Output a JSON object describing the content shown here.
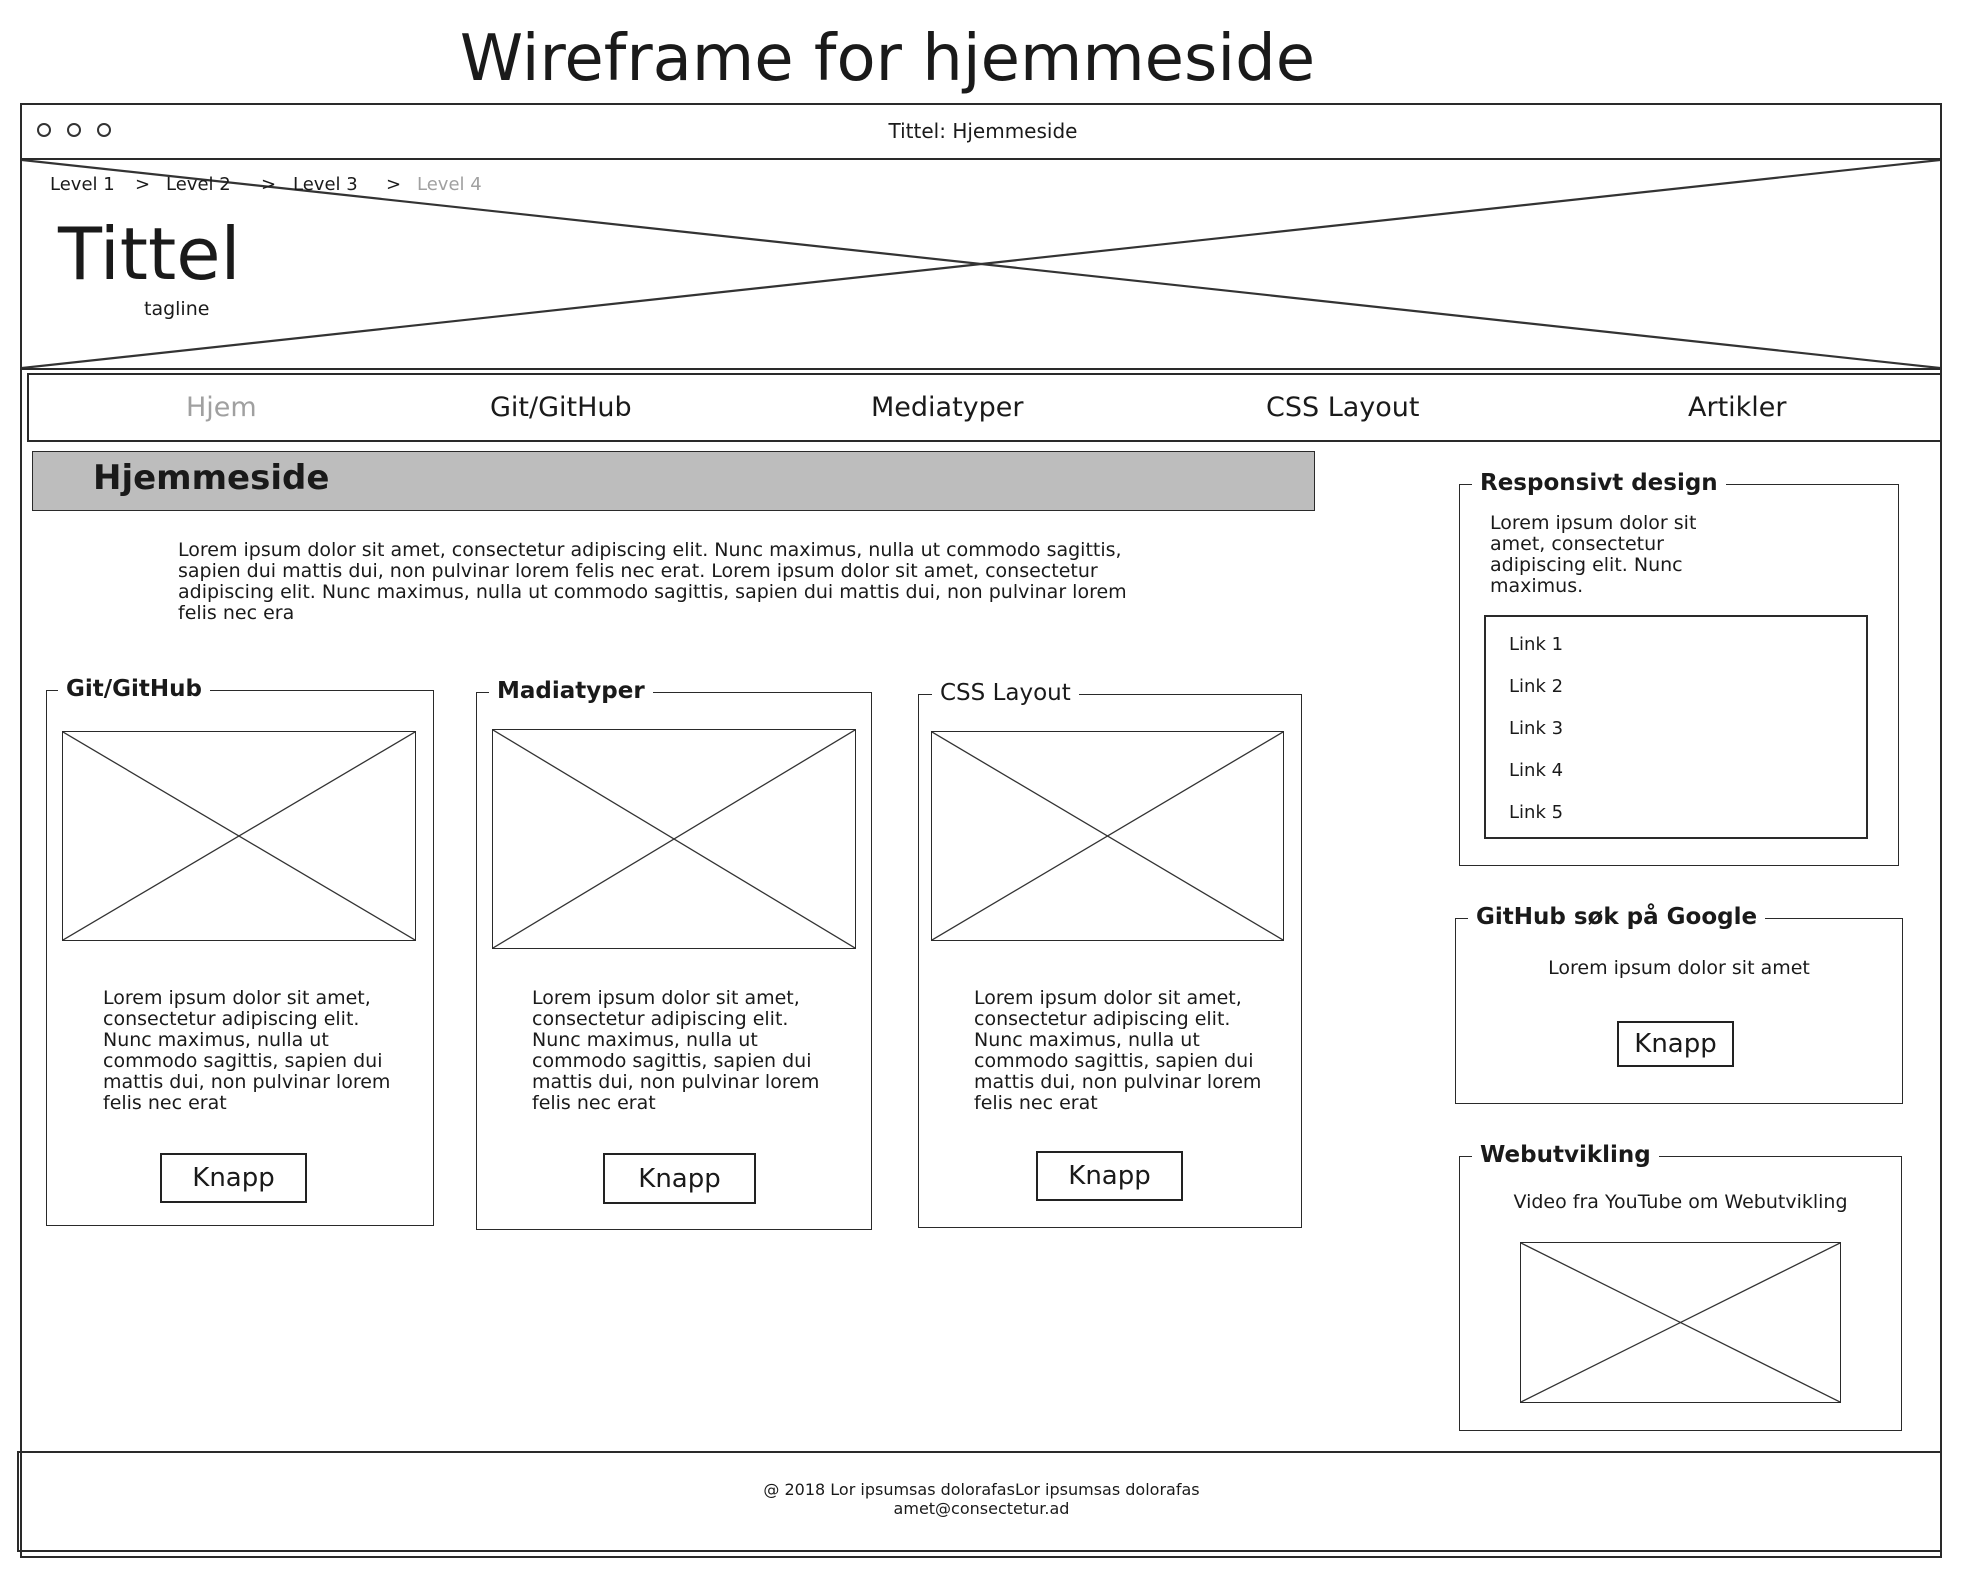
{
  "diagram_title": "Wireframe for hjemmeside",
  "browser": {
    "title": "Tittel: Hjemmeside"
  },
  "breadcrumb": {
    "items": [
      "Level 1",
      "Level 2",
      "Level 3",
      "Level 4"
    ],
    "separator": ">"
  },
  "header": {
    "title": "Tittel",
    "tagline": "tagline"
  },
  "nav": {
    "items": [
      "Hjem",
      "Git/GitHub",
      "Mediatyper",
      "CSS Layout",
      "Artikler"
    ]
  },
  "main": {
    "heading": "Hjemmeside",
    "intro": "Lorem ipsum dolor sit amet, consectetur adipiscing elit. Nunc maximus, nulla ut commodo sagittis, sapien dui mattis dui, non pulvinar lorem felis nec erat. Lorem ipsum dolor sit amet, consectetur adipiscing elit. Nunc maximus, nulla ut commodo sagittis, sapien dui mattis dui, non pulvinar lorem felis nec era",
    "cards": [
      {
        "title": "Git/GitHub",
        "text": "Lorem ipsum dolor sit amet, consectetur adipiscing elit. Nunc maximus, nulla ut commodo sagittis, sapien dui mattis dui, non pulvinar lorem felis nec erat",
        "button": "Knapp"
      },
      {
        "title": "Madiatyper",
        "text": "Lorem ipsum dolor sit amet, consectetur adipiscing elit. Nunc maximus, nulla ut commodo sagittis, sapien dui mattis dui, non pulvinar lorem felis nec erat",
        "button": "Knapp"
      },
      {
        "title": "CSS Layout",
        "text": "Lorem ipsum dolor sit amet, consectetur adipiscing elit. Nunc maximus, nulla ut commodo sagittis, sapien dui mattis dui, non pulvinar lorem felis nec erat",
        "button": "Knapp"
      }
    ]
  },
  "sidebar": {
    "responsive": {
      "title": "Responsivt design",
      "text": "Lorem ipsum dolor sit amet, consectetur adipiscing elit. Nunc maximus.",
      "links": [
        "Link 1",
        "Link 2",
        "Link 3",
        "Link 4",
        "Link 5"
      ]
    },
    "github": {
      "title": "GitHub søk på Google",
      "text": "Lorem ipsum dolor sit amet",
      "button": "Knapp"
    },
    "webdev": {
      "title": "Webutvikling",
      "text": "Video fra YouTube om Webutvikling"
    }
  },
  "footer": {
    "line1": "@ 2018 Lor ipsumsas dolorafasLor ipsumsas dolorafas",
    "line2": "amet@consectetur.ad"
  },
  "colors": {
    "stroke": "#2a2a2a",
    "heading_band": "#bdbdbd",
    "muted_text": "#a0a0a0"
  }
}
